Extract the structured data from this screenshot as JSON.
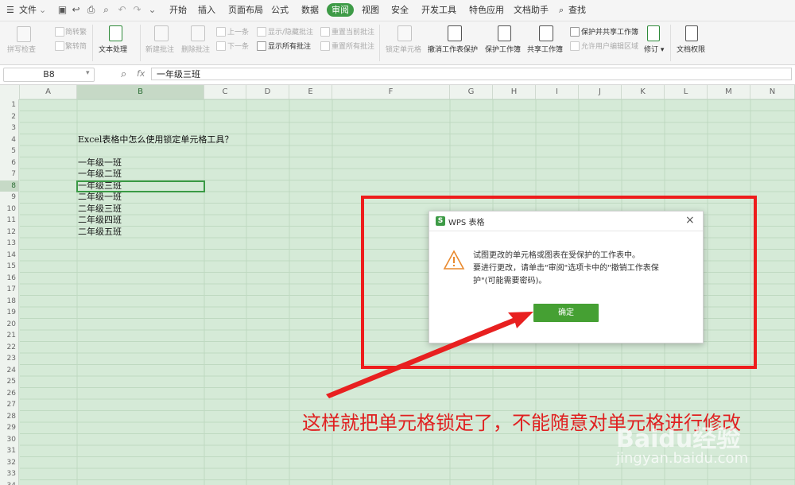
{
  "menubar": {
    "file_label": "文件",
    "tabs": [
      {
        "label": "开始"
      },
      {
        "label": "插入"
      },
      {
        "label": "页面布局"
      },
      {
        "label": "公式"
      },
      {
        "label": "数据"
      },
      {
        "label": "审阅"
      },
      {
        "label": "视图"
      },
      {
        "label": "安全"
      },
      {
        "label": "开发工具"
      },
      {
        "label": "特色应用"
      },
      {
        "label": "文档助手"
      }
    ],
    "active_tab": "审阅",
    "search_label": "查找"
  },
  "ribbon": {
    "spell_check": "拼写检查",
    "to_traditional": "简转繁",
    "to_simplified": "繁转简",
    "text_processing": "文本处理",
    "new_comment": "新建批注",
    "delete_comment": "删除批注",
    "prev_comment": "上一条",
    "next_comment": "下一条",
    "show_hide_comment": "显示/隐藏批注",
    "show_all_comments": "显示所有批注",
    "reset_current_comment": "重置当前批注",
    "reset_all_comments": "重置所有批注",
    "lock_cell": "锁定单元格",
    "unprotect_sheet": "撤消工作表保护",
    "protect_workbook": "保护工作簿",
    "share_workbook": "共享工作簿",
    "protect_and_share": "保护并共享工作簿",
    "allow_edit_ranges": "允许用户编辑区域",
    "revisions": "修订",
    "doc_permissions": "文档权限"
  },
  "formula_bar": {
    "name_box": "B8",
    "fx": "fx",
    "value": "一年级三班"
  },
  "grid": {
    "columns": [
      "A",
      "B",
      "C",
      "D",
      "E",
      "F",
      "G",
      "H",
      "I",
      "J",
      "K",
      "L",
      "M",
      "N"
    ],
    "selected_column": "B",
    "selected_row": 8,
    "cells": [
      {
        "row": 4,
        "text": "Excel表格中怎么使用锁定单元格工具？"
      },
      {
        "row": 6,
        "text": "一年级一班"
      },
      {
        "row": 7,
        "text": "一年级二班"
      },
      {
        "row": 8,
        "text": "一年级三班"
      },
      {
        "row": 9,
        "text": "二年级一班"
      },
      {
        "row": 10,
        "text": "二年级三班"
      },
      {
        "row": 11,
        "text": "二年级四班"
      },
      {
        "row": 12,
        "text": "二年级五班"
      }
    ]
  },
  "dialog": {
    "title": "WPS 表格",
    "message_line1": "试图更改的单元格或图表在受保护的工作表中。",
    "message_line2": "要进行更改，请单击\"审阅\"选项卡中的\"撤销工作表保",
    "message_line3": "护\"(可能需要密码)。",
    "ok_label": "确定"
  },
  "annotation": {
    "caption": "这样就把单元格锁定了，不能随意对单元格进行修改",
    "accent": "#e02020"
  },
  "watermark": {
    "logo": "Baidu经验",
    "url": "jingyan.baidu.com"
  }
}
